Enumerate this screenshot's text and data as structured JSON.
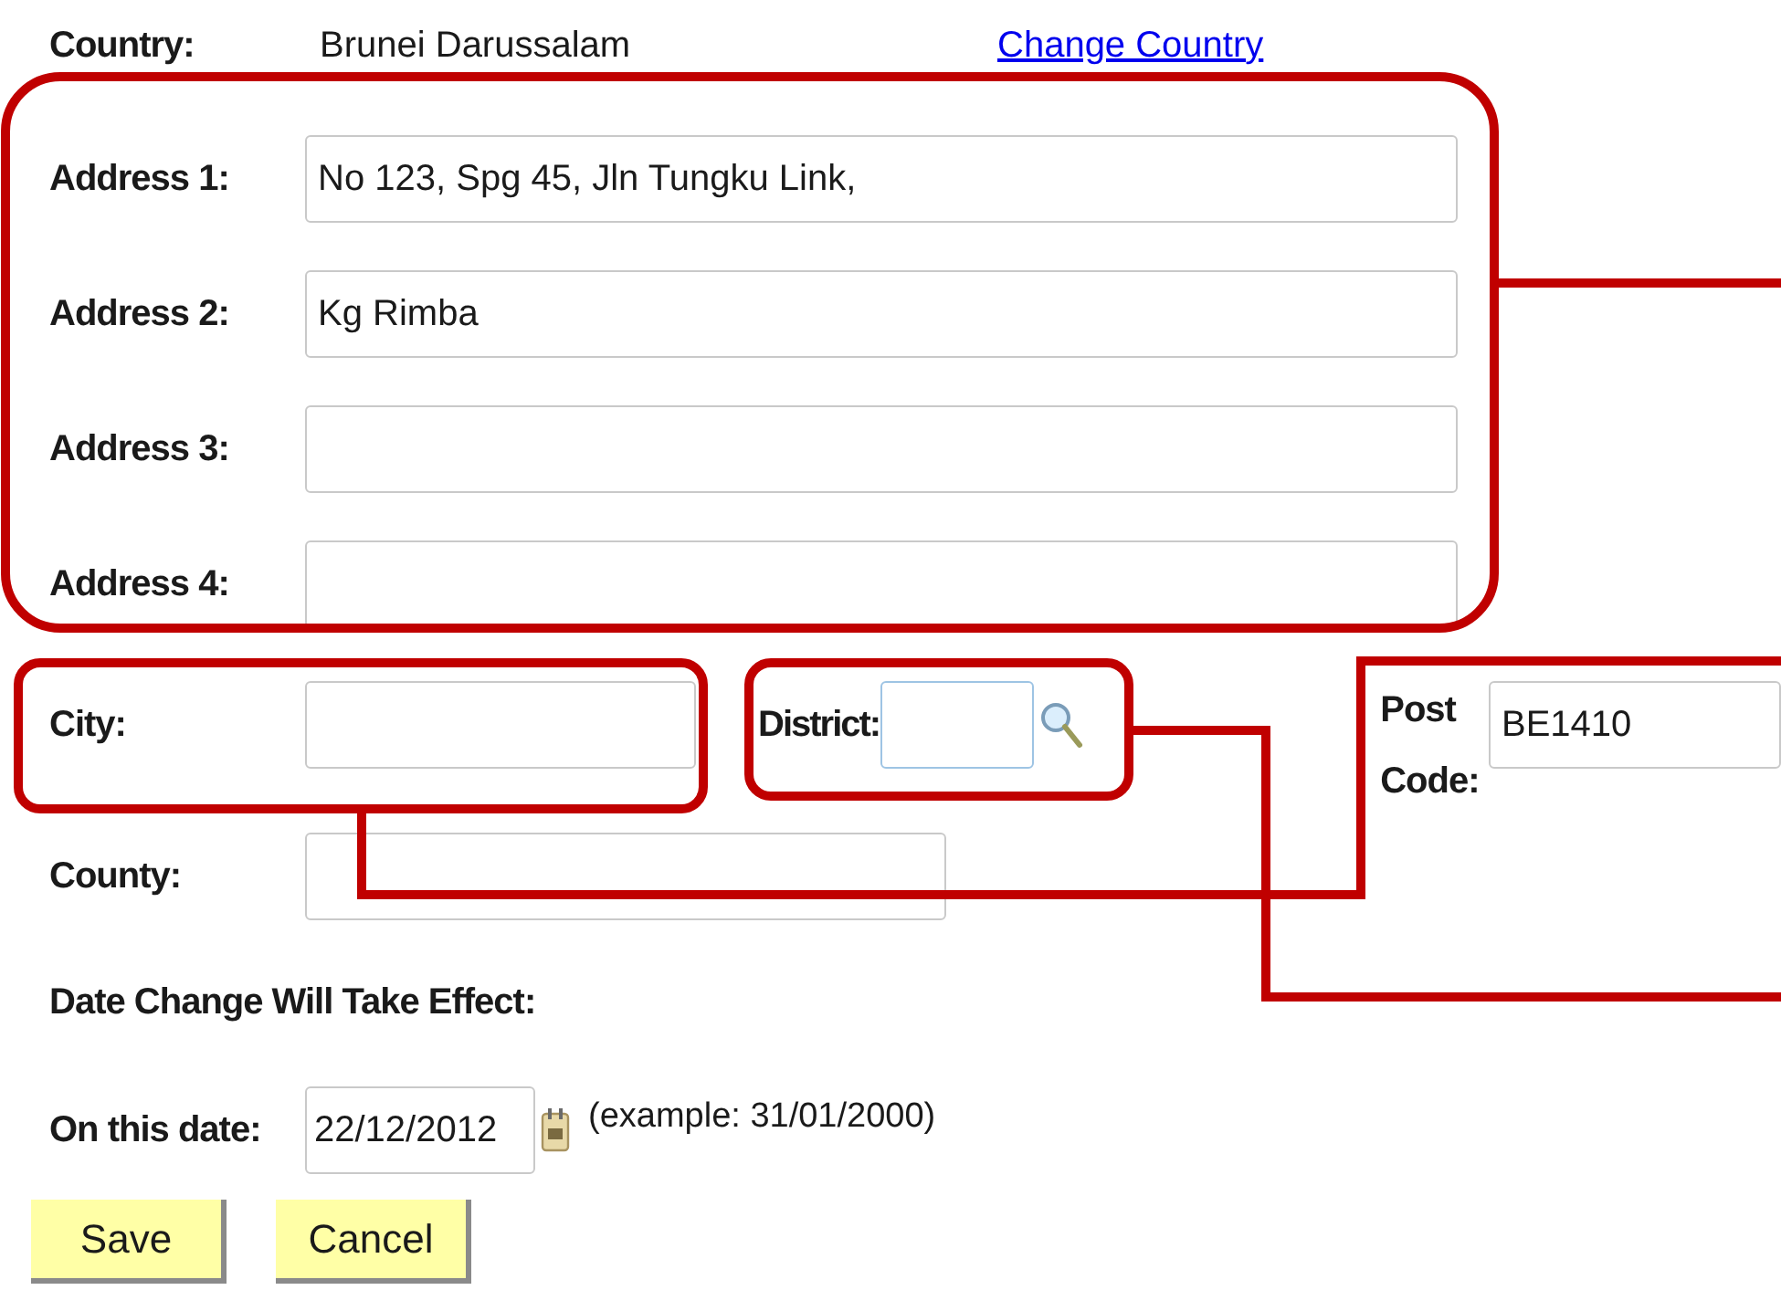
{
  "country": {
    "label": "Country:",
    "value": "Brunei Darussalam",
    "link": "Change Country"
  },
  "address_fields": [
    {
      "label": "Address 1:",
      "value": "No 123, Spg 45, Jln Tungku Link,"
    },
    {
      "label": "Address 2:",
      "value": "Kg Rimba"
    },
    {
      "label": "Address 3:"
    },
    {
      "label": "Address 4:"
    }
  ],
  "city": {
    "label": "City:"
  },
  "district": {
    "label": "District:"
  },
  "post_code": {
    "label": "Post Code:",
    "value": "BE1410"
  },
  "county": {
    "label": "County:"
  },
  "date_heading": "Date Change Will Take Effect:",
  "effective_date": {
    "label": "On this date:",
    "value": "22/12/2012",
    "example": "(example: 31/01/2000)"
  },
  "buttons": [
    "Save",
    "Cancel"
  ]
}
